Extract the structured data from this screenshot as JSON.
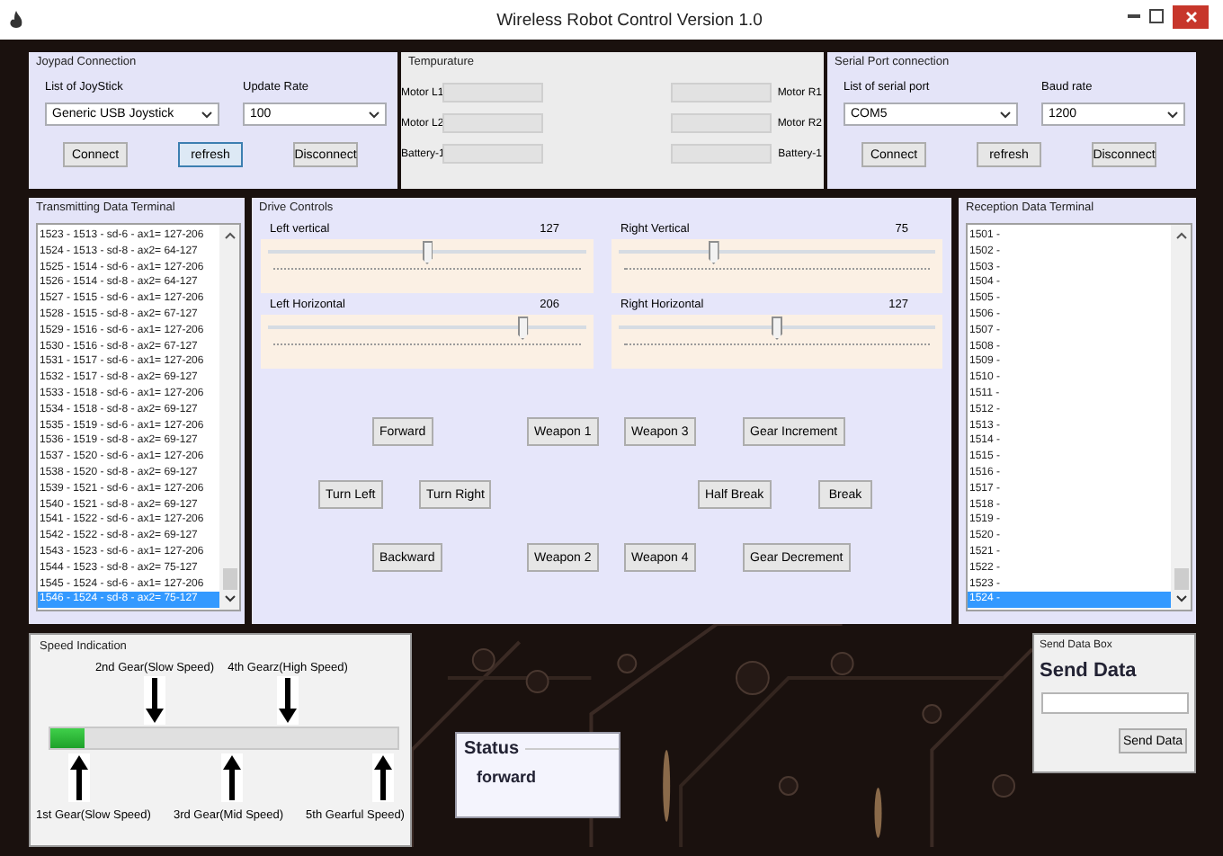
{
  "window": {
    "title": "Wireless Robot Control Version 1.0"
  },
  "joypad": {
    "title": "Joypad Connection",
    "device": {
      "label": "List of JoyStick",
      "value": "Generic  USB Joystick"
    },
    "rate": {
      "label": "Update Rate",
      "value": "100"
    },
    "buttons": [
      {
        "label": "Connect",
        "focused": false
      },
      {
        "label": "refresh",
        "focused": true
      },
      {
        "label": "Disconnect",
        "focused": false
      }
    ]
  },
  "temperature": {
    "title": "Tempurature",
    "left": [
      {
        "label": "Motor L1"
      },
      {
        "label": "Motor L2"
      },
      {
        "label": "Battery-1"
      }
    ],
    "right": [
      {
        "label": "Motor R1"
      },
      {
        "label": "Motor R2"
      },
      {
        "label": "Battery-1"
      }
    ]
  },
  "serial": {
    "title": "Serial Port connection",
    "device": {
      "label": "List of serial port",
      "value": "COM5"
    },
    "rate": {
      "label": "Baud rate",
      "value": "1200"
    },
    "buttons": [
      {
        "label": "Connect",
        "focused": false
      },
      {
        "label": "refresh",
        "focused": false
      },
      {
        "label": "Disconnect",
        "focused": false
      }
    ]
  },
  "transmitting": {
    "title": "Transmitting Data Terminal",
    "lines": [
      {
        "text": "1523 - 1513 - sd-6 - ax1= 127-206",
        "selected": false
      },
      {
        "text": "1524 - 1513 - sd-8 - ax2= 64-127",
        "selected": false
      },
      {
        "text": "1525 - 1514 - sd-6 - ax1= 127-206",
        "selected": false
      },
      {
        "text": "1526 - 1514 - sd-8 - ax2= 64-127",
        "selected": false
      },
      {
        "text": "1527 - 1515 - sd-6 - ax1= 127-206",
        "selected": false
      },
      {
        "text": "1528 - 1515 - sd-8 - ax2= 67-127",
        "selected": false
      },
      {
        "text": "1529 - 1516 - sd-6 - ax1= 127-206",
        "selected": false
      },
      {
        "text": "1530 - 1516 - sd-8 - ax2= 67-127",
        "selected": false
      },
      {
        "text": "1531 - 1517 - sd-6 - ax1= 127-206",
        "selected": false
      },
      {
        "text": "1532 - 1517 - sd-8 - ax2= 69-127",
        "selected": false
      },
      {
        "text": "1533 - 1518 - sd-6 - ax1= 127-206",
        "selected": false
      },
      {
        "text": "1534 - 1518 - sd-8 - ax2= 69-127",
        "selected": false
      },
      {
        "text": "1535 - 1519 - sd-6 - ax1= 127-206",
        "selected": false
      },
      {
        "text": "1536 - 1519 - sd-8 - ax2= 69-127",
        "selected": false
      },
      {
        "text": "1537 - 1520 - sd-6 - ax1= 127-206",
        "selected": false
      },
      {
        "text": "1538 - 1520 - sd-8 - ax2= 69-127",
        "selected": false
      },
      {
        "text": "1539 - 1521 - sd-6 - ax1= 127-206",
        "selected": false
      },
      {
        "text": "1540 - 1521 - sd-8 - ax2= 69-127",
        "selected": false
      },
      {
        "text": "1541 - 1522 - sd-6 - ax1= 127-206",
        "selected": false
      },
      {
        "text": "1542 - 1522 - sd-8 - ax2= 69-127",
        "selected": false
      },
      {
        "text": "1543 - 1523 - sd-6 - ax1= 127-206",
        "selected": false
      },
      {
        "text": "1544 - 1523 - sd-8 - ax2= 75-127",
        "selected": false
      },
      {
        "text": "1545 - 1524 - sd-6 - ax1= 127-206",
        "selected": false
      },
      {
        "text": "1546 - 1524 - sd-8 - ax2= 75-127",
        "selected": true
      }
    ]
  },
  "drive": {
    "title": "Drive Controls",
    "sliders": [
      {
        "label": "Left vertical",
        "reading": "127",
        "level": 0.5
      },
      {
        "label": "Right Vertical",
        "reading": "75",
        "level": 0.3
      },
      {
        "label": "Left Horizontal",
        "reading": "206",
        "level": 0.8
      },
      {
        "label": "Right Horizontal",
        "reading": "127",
        "level": 0.5
      }
    ],
    "button_rows": [
      [
        "Forward",
        "Weapon 1",
        "Weapon 3",
        "Gear Increment"
      ],
      [
        "Turn Left",
        "Turn Right",
        "Half Break",
        "Break"
      ],
      [
        "Backward",
        "Weapon 2",
        "Weapon 4",
        "Gear Decrement"
      ]
    ]
  },
  "reception": {
    "title": "Reception Data Terminal",
    "lines": [
      {
        "text": "1501 -",
        "selected": false
      },
      {
        "text": "1502 -",
        "selected": false
      },
      {
        "text": "1503 -",
        "selected": false
      },
      {
        "text": "1504 -",
        "selected": false
      },
      {
        "text": "1505 -",
        "selected": false
      },
      {
        "text": "1506 -",
        "selected": false
      },
      {
        "text": "1507 -",
        "selected": false
      },
      {
        "text": "1508 -",
        "selected": false
      },
      {
        "text": "1509 -",
        "selected": false
      },
      {
        "text": "1510 -",
        "selected": false
      },
      {
        "text": "1511 -",
        "selected": false
      },
      {
        "text": "1512 -",
        "selected": false
      },
      {
        "text": "1513 -",
        "selected": false
      },
      {
        "text": "1514 -",
        "selected": false
      },
      {
        "text": "1515 -",
        "selected": false
      },
      {
        "text": "1516 -",
        "selected": false
      },
      {
        "text": "1517 -",
        "selected": false
      },
      {
        "text": "1518 -",
        "selected": false
      },
      {
        "text": "1519 -",
        "selected": false
      },
      {
        "text": "1520 -",
        "selected": false
      },
      {
        "text": "1521 -",
        "selected": false
      },
      {
        "text": "1522 -",
        "selected": false
      },
      {
        "text": "1523 -",
        "selected": false
      },
      {
        "text": "1524 -",
        "selected": true
      }
    ]
  },
  "speed": {
    "title": "Speed Indication",
    "upper_labels": [
      "2nd Gear(Slow Speed)",
      "4th Gearz(High Speed)"
    ],
    "lower_labels": [
      "1st Gear(Slow Speed)",
      "3rd Gear(Mid Speed)",
      "5th Gearful Speed)"
    ],
    "level": 0.1
  },
  "status": {
    "title": "Status",
    "value": "forward"
  },
  "send": {
    "title": "Send Data Box",
    "heading": "Send Data",
    "button": "Send Data"
  }
}
